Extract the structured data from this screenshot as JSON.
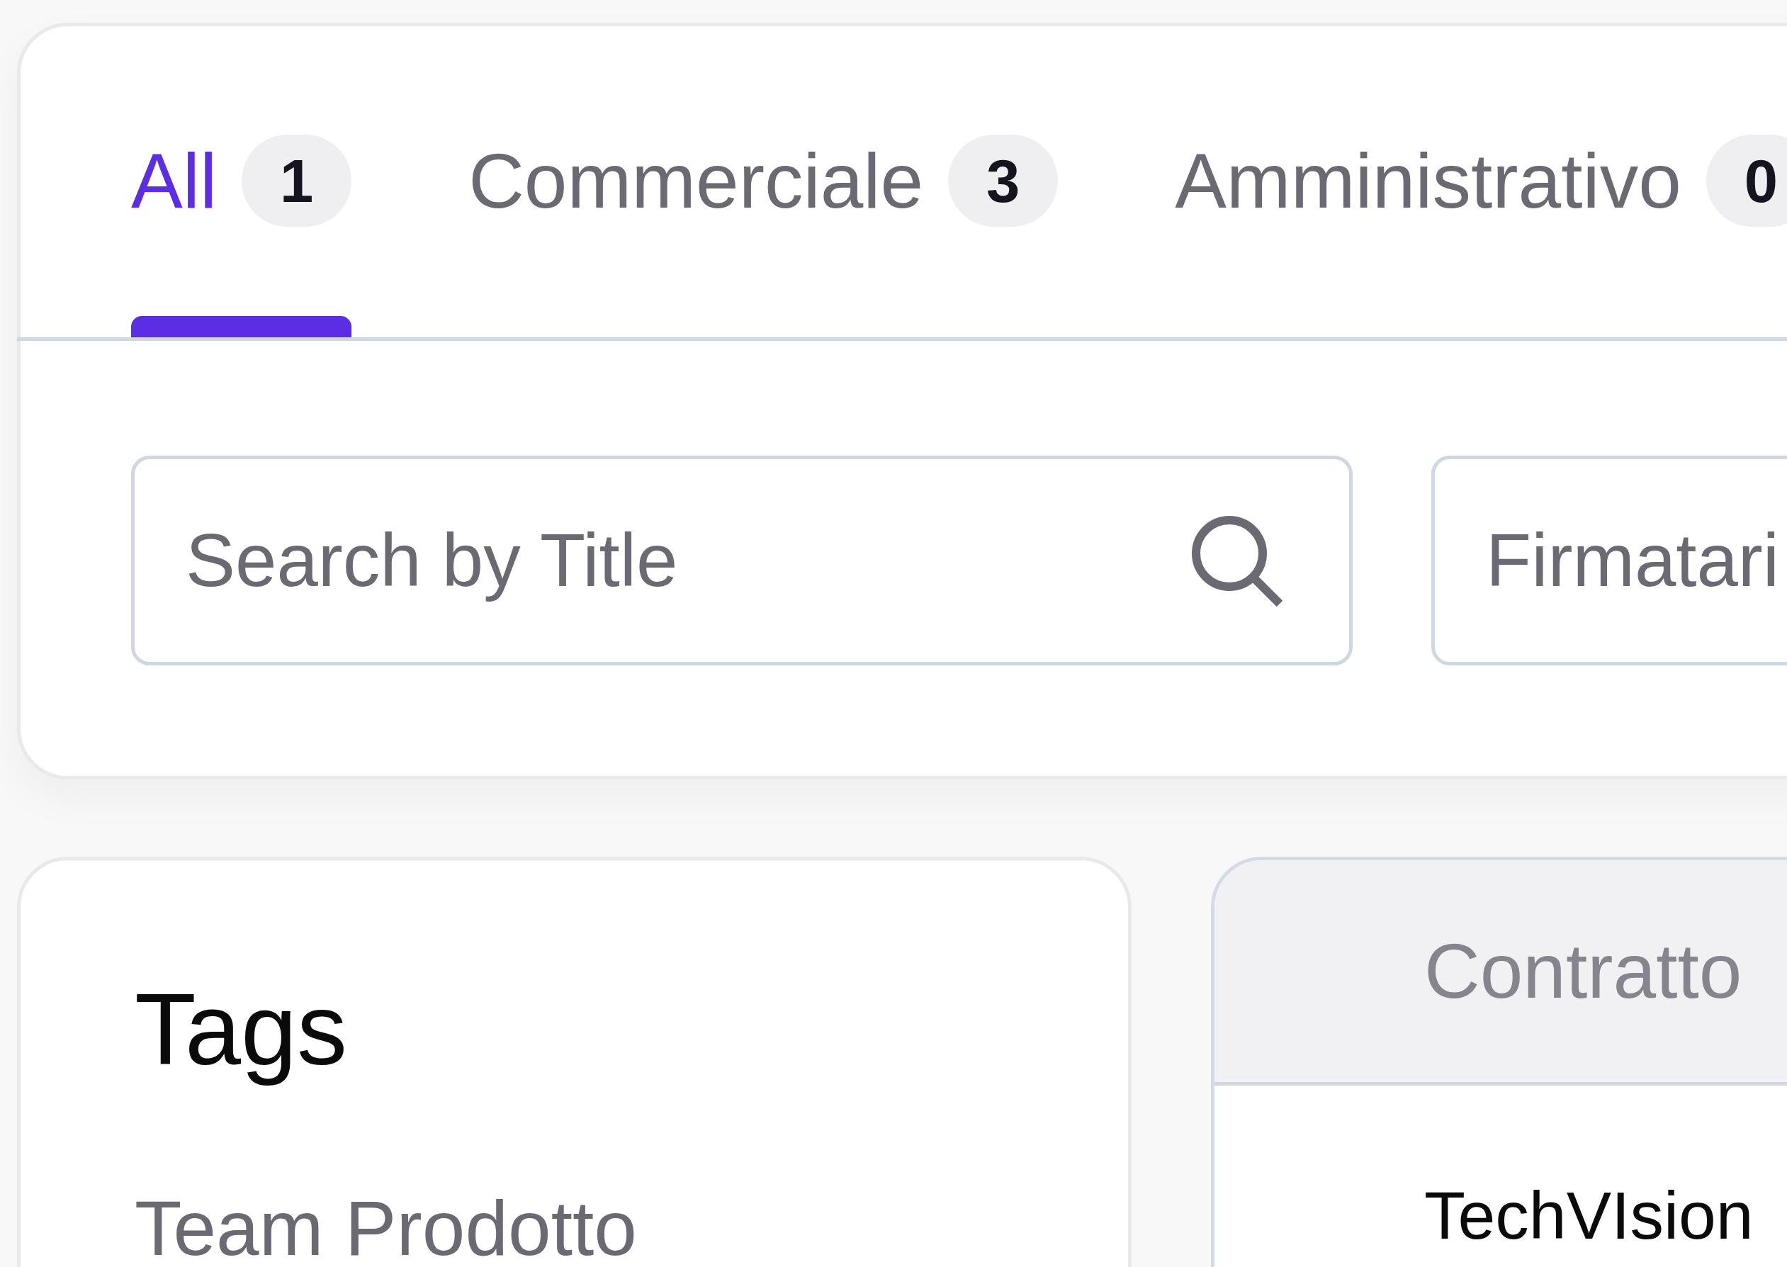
{
  "tabs": [
    {
      "label": "All",
      "count": "1",
      "selected": true
    },
    {
      "label": "Commerciale",
      "count": "3",
      "selected": false
    },
    {
      "label": "Amministrativo",
      "count": "0",
      "selected": false
    }
  ],
  "filters": [
    {
      "kind": "search",
      "placeholder": "Search by Title"
    },
    {
      "kind": "select",
      "placeholder": "Firmatari"
    }
  ],
  "tags_panel": {
    "title": "Tags",
    "items": [
      {
        "label": "Team Prodotto"
      }
    ]
  },
  "table": {
    "columns": [
      "Contratto"
    ],
    "rows": [
      [
        "TechVIsion"
      ]
    ]
  }
}
